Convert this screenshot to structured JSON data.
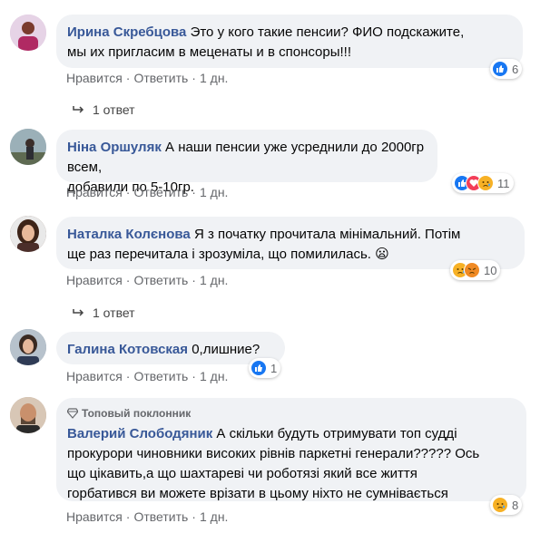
{
  "actions": {
    "like": "Нравится",
    "reply": "Ответить",
    "sep": "·"
  },
  "comments": [
    {
      "author": "Ирина Скребцова",
      "text_lines": [
        "Это у кого такие пенсии? ФИО подскажите,",
        "мы их пригласим в меценаты и в спонсоры!!!"
      ],
      "time": "1 дн.",
      "reactions": [
        "like"
      ],
      "reaction_count": "6"
    },
    {
      "author": "Ніна Оршуляк",
      "text_lines": [
        "А наши пенсии уже усреднили до 2000гр всем,",
        "добавили по 5-10гр."
      ],
      "time": "1 дн.",
      "reactions": [
        "like",
        "love",
        "sad"
      ],
      "reaction_count": "11"
    },
    {
      "author": "Наталка Колєнова",
      "text_lines": [
        "Я з початку прочитала мінімальний. Потім",
        "ще раз перечитала і зрозуміла, що помилилась. 😦"
      ],
      "time": "1 дн.",
      "reactions": [
        "sad",
        "angry"
      ],
      "reaction_count": "10"
    },
    {
      "author": "Галина Котовская",
      "text_lines": [
        "0,лишние?"
      ],
      "time": "1 дн.",
      "reactions": [
        "like"
      ],
      "reaction_count": "1"
    },
    {
      "author": "Валерий Слободяник",
      "badge": "Топовый поклонник",
      "text_lines": [
        "А скільки будуть отримувати топ судді",
        "прокурори чиновники високих рівнів паркетні генерали????? Ось",
        "що цікавить,а що шахтареві чи роботязі який все життя",
        "горбатився ви можете врізати в цьому ніхто не сумнівається"
      ],
      "time": "1 дн.",
      "reactions": [
        "sad"
      ],
      "reaction_count": "8"
    }
  ],
  "replies": [
    {
      "label": "1 ответ"
    },
    {
      "label": "1 ответ"
    }
  ],
  "colors": {
    "bubble": "#f0f2f5",
    "author": "#385898",
    "meta": "#65676b",
    "like": "#1877f2",
    "love": "#f33e58",
    "face": "#f7b125"
  }
}
